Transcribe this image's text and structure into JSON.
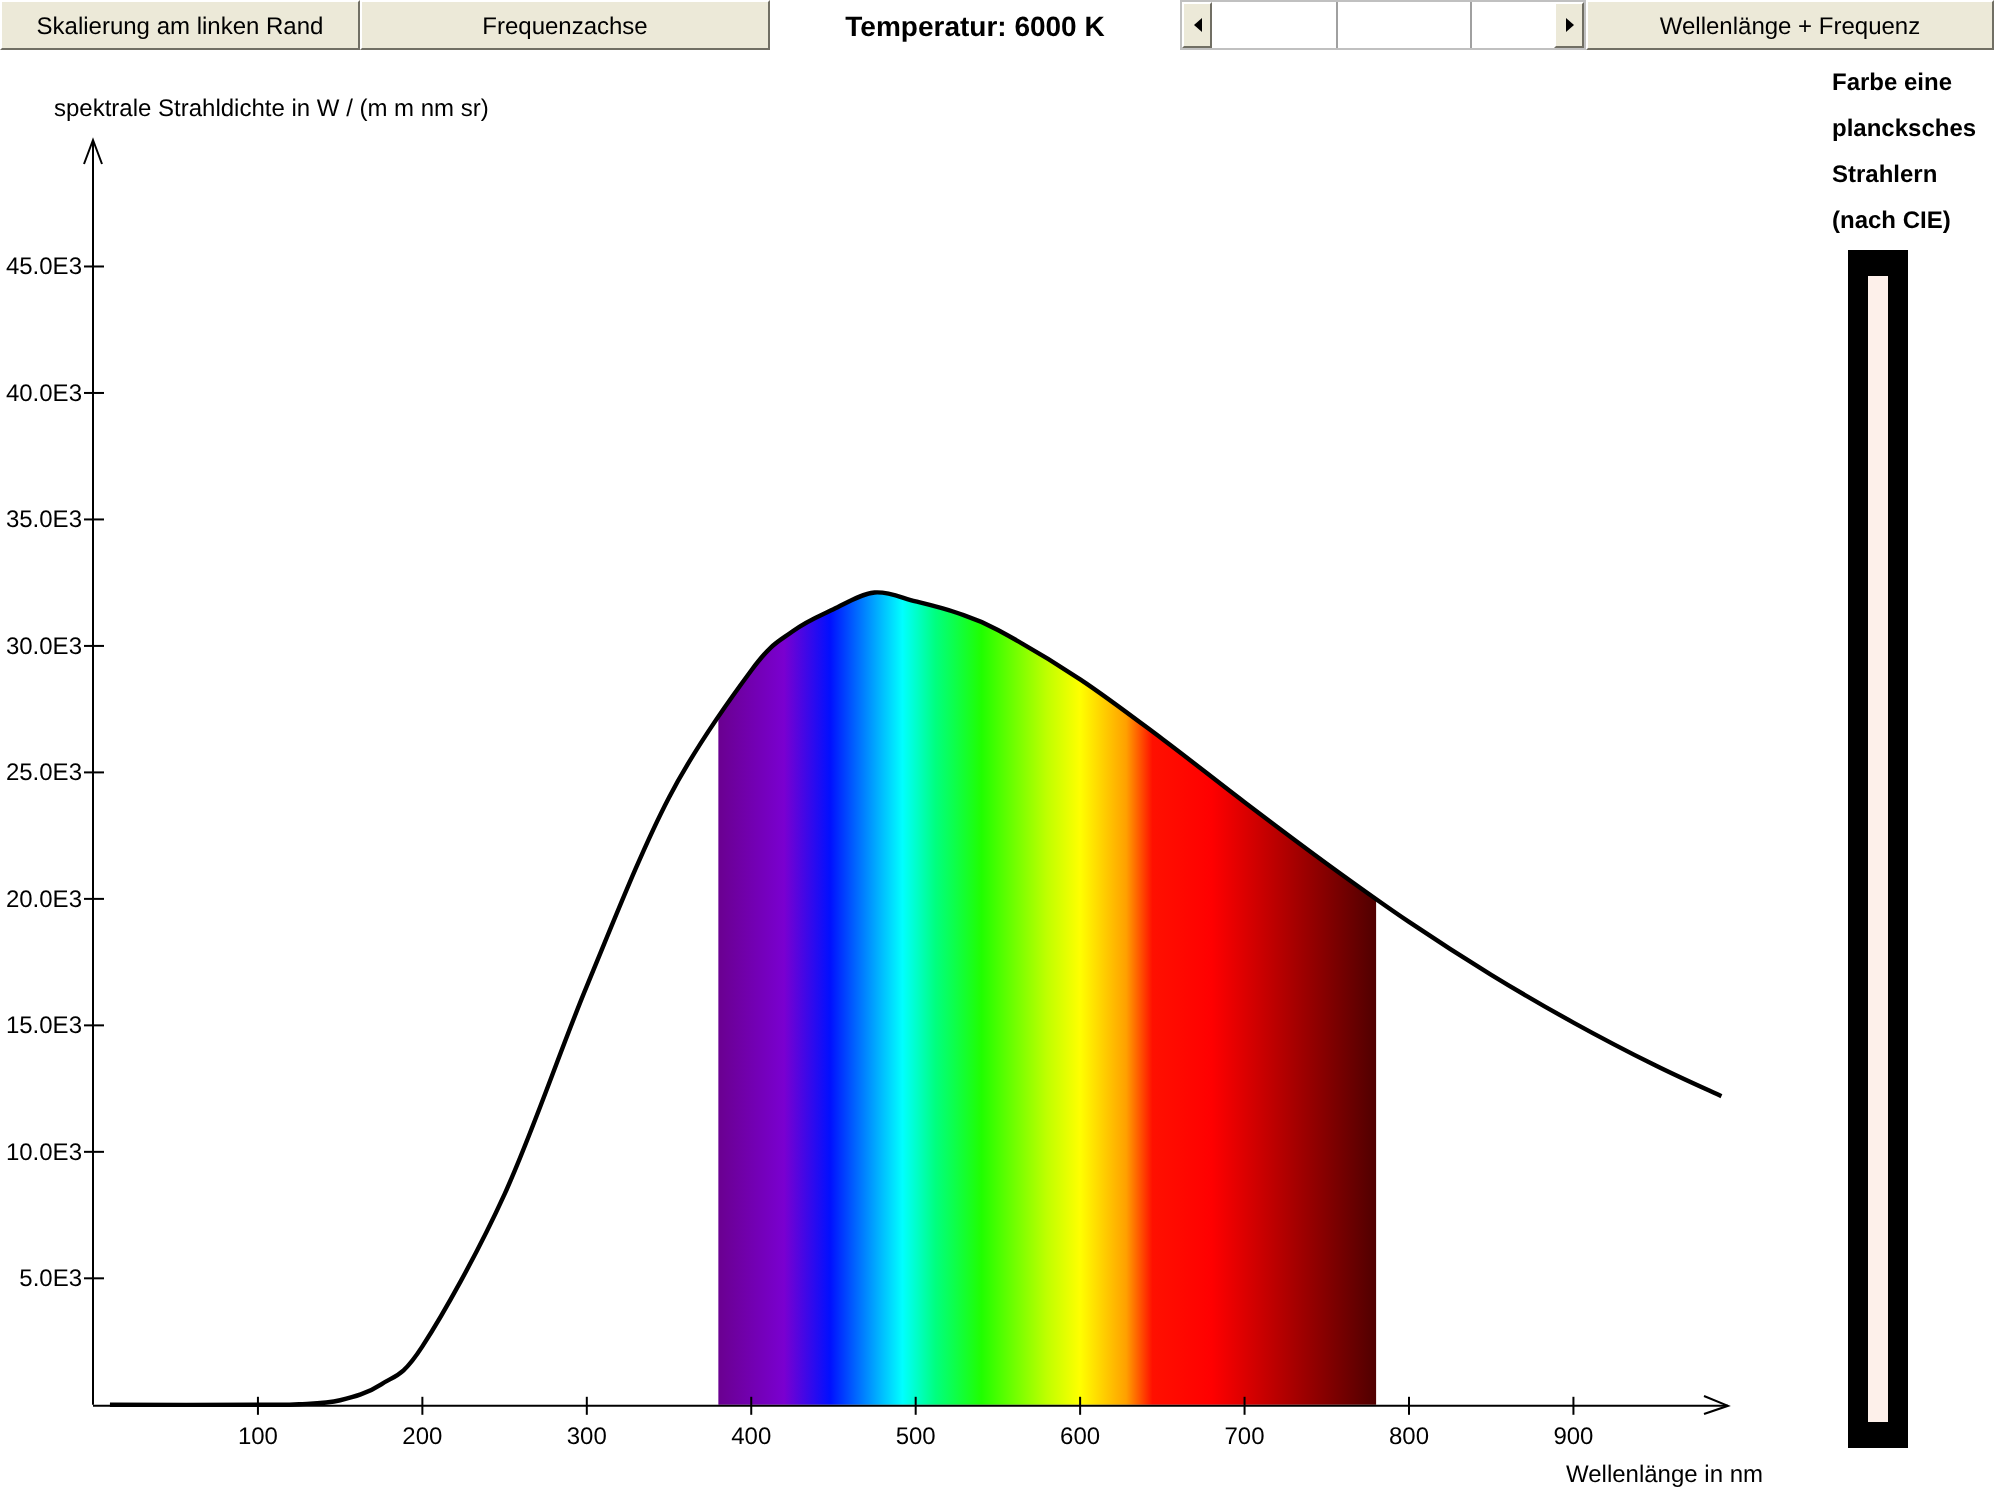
{
  "toolbar": {
    "buttons": [
      {
        "label": "Skalierung am linken Rand"
      },
      {
        "label": "Frequenzachse"
      }
    ],
    "temperature": "Temperatur: 6000 K",
    "scrollbar": {
      "level": 0.6
    },
    "mode_button": {
      "label": "Wellenlänge + Frequenz"
    }
  },
  "chart": {
    "chart_data": {
      "type": "line",
      "ylabel": "spektrale Strahldichte in W / (m m nm sr)",
      "xlabel": "Wellenlänge in nm",
      "x": [
        10,
        100,
        125,
        150,
        175,
        200,
        250,
        300,
        350,
        400,
        425,
        450,
        475,
        500,
        525,
        550,
        600,
        650,
        700,
        750,
        800,
        850,
        900,
        950,
        990
      ],
      "series": [
        {
          "color": "#000000",
          "values": [
            0,
            0,
            20,
            180,
            810,
            2310,
            8330,
            16550,
            24010,
            29030,
            30570,
            31450,
            32110,
            31760,
            31310,
            30630,
            28680,
            26320,
            23820,
            21390,
            19090,
            17000,
            15110,
            13410,
            12200
          ]
        }
      ],
      "xlim": [
        0,
        994
      ],
      "ylim": [
        0,
        50000
      ],
      "xticks": [
        100,
        200,
        300,
        400,
        500,
        600,
        700,
        800,
        900
      ],
      "yticks": [
        {
          "value": 5000,
          "label": "5.0E3"
        },
        {
          "value": 10000,
          "label": "10.0E3"
        },
        {
          "value": 15000,
          "label": "15.0E3"
        },
        {
          "value": 20000,
          "label": "20.0E3"
        },
        {
          "value": 25000,
          "label": "25.0E3"
        },
        {
          "value": 30000,
          "label": "30.0E3"
        },
        {
          "value": 35000,
          "label": "35.0E3"
        },
        {
          "value": 40000,
          "label": "40.0E3"
        },
        {
          "value": 45000,
          "label": "45.0E3"
        }
      ]
    }
  },
  "color_panel": {
    "lines": [
      "Farbe eine",
      "plancksches",
      "Strahlern",
      "(nach CIE)"
    ],
    "color": "#fdf0ea"
  }
}
